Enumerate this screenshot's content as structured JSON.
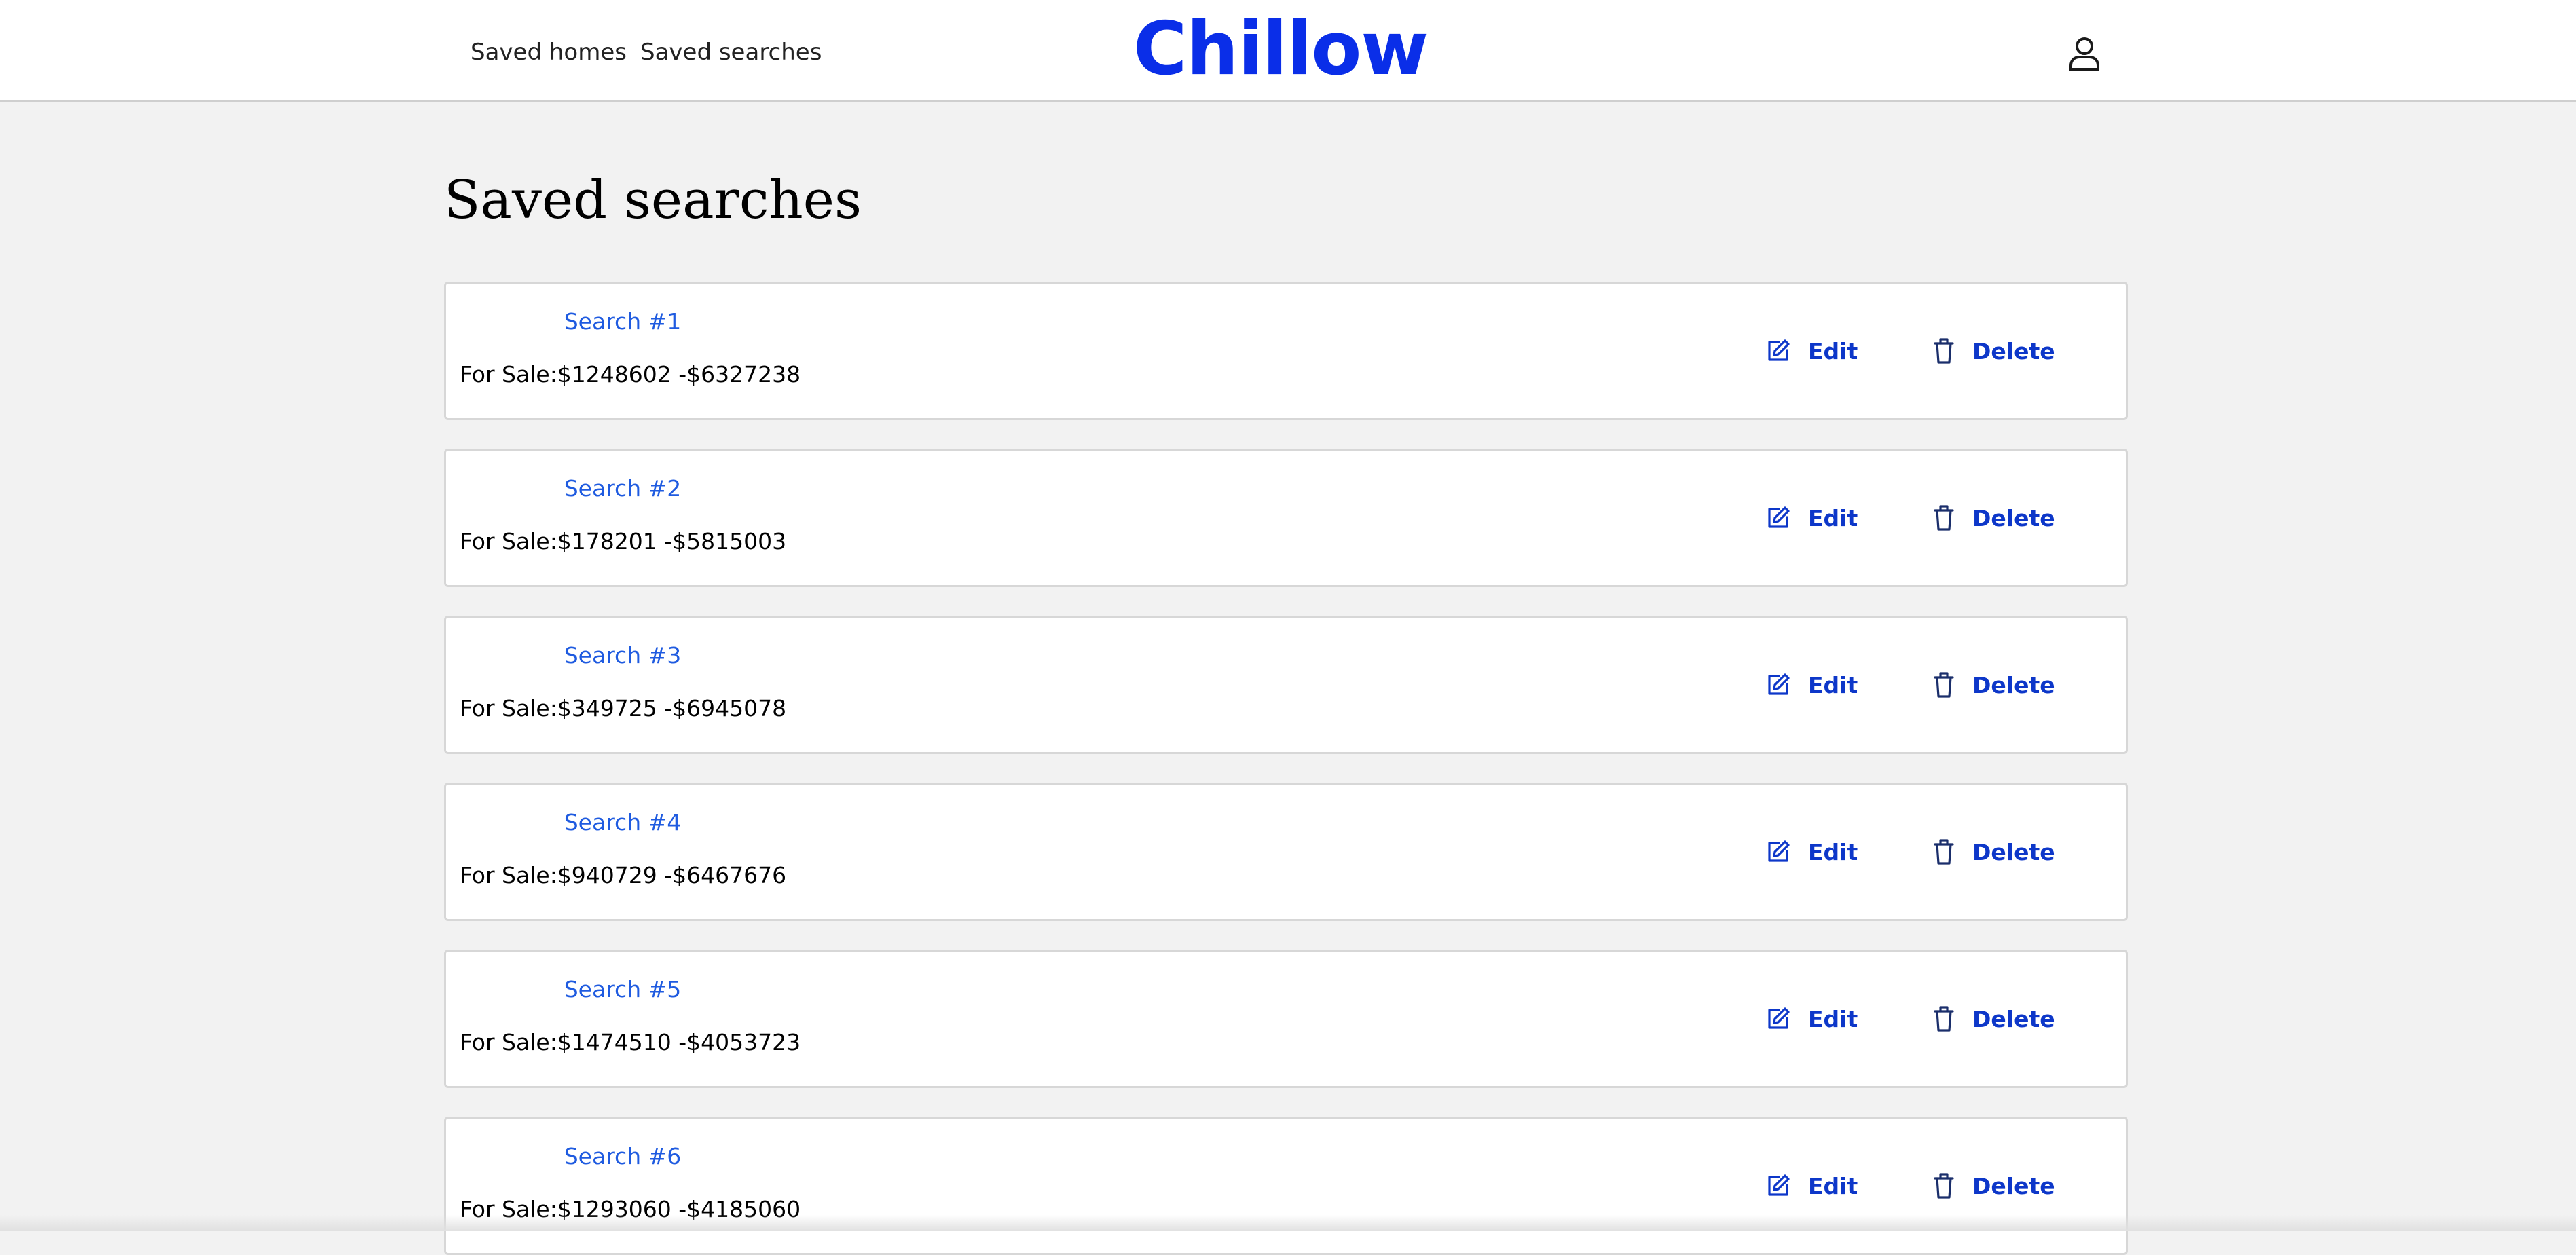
{
  "header": {
    "nav": {
      "saved_homes": "Saved homes",
      "saved_searches": "Saved searches"
    },
    "brand": "Chillow",
    "profile_icon": "user-icon"
  },
  "page": {
    "title": "Saved searches"
  },
  "actions": {
    "edit_label": "Edit",
    "edit_icon": "edit-icon",
    "delete_label": "Delete",
    "delete_icon": "trash-icon"
  },
  "searches": [
    {
      "name": "Search #1",
      "range": "For Sale:$1248602 -$6327238"
    },
    {
      "name": "Search #2",
      "range": "For Sale:$178201 -$5815003"
    },
    {
      "name": "Search #3",
      "range": "For Sale:$349725 -$6945078"
    },
    {
      "name": "Search #4",
      "range": "For Sale:$940729 -$6467676"
    },
    {
      "name": "Search #5",
      "range": "For Sale:$1474510 -$4053723"
    },
    {
      "name": "Search #6",
      "range": "For Sale:$1293060 -$4185060"
    }
  ],
  "colors": {
    "brand": "#0a2ee8",
    "link": "#1f5be0",
    "action": "#0d37c9",
    "background": "#f2f2f2"
  }
}
